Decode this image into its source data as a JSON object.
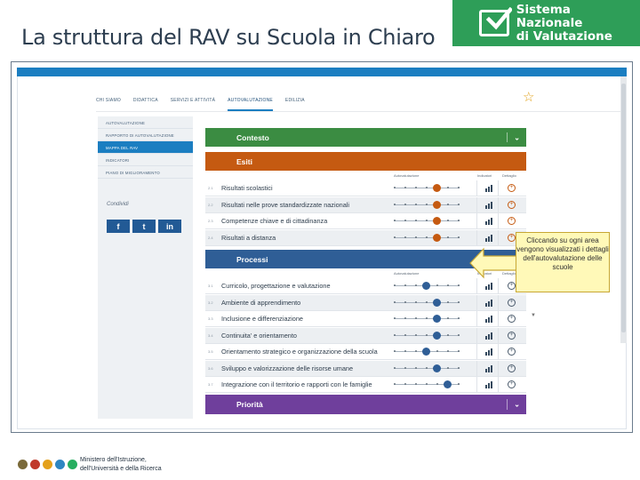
{
  "slide": {
    "title": "La struttura del RAV su Scuola in Chiaro"
  },
  "brand": {
    "line1": "Sistema Nazionale",
    "line2": "di Valutazione",
    "color": "#2e9e58"
  },
  "nav": {
    "items": [
      "CHI SIAMO",
      "DIDATTICA",
      "SERVIZI E ATTIVITÀ",
      "AUTOVALUTAZIONE",
      "EDILIZIA"
    ],
    "active": "AUTOVALUTAZIONE",
    "star": "☆"
  },
  "sidebar": {
    "items": [
      "AUTOVALUTAZIONE",
      "RAPPORTO DI AUTOVALUTAZIONE",
      "MAPPA DEL RAV",
      "INDICATORI",
      "PIANO DI MIGLIORAMENTO"
    ],
    "selected_index": 2,
    "share_label": "Condividi",
    "social": [
      "f",
      "t",
      "in"
    ]
  },
  "sections": {
    "contesto": {
      "label": "Contesto",
      "color": "#3b8c42",
      "chevron": "⌄"
    },
    "esiti": {
      "label": "Esiti",
      "color": "#c55a11",
      "chevron": "⌄"
    },
    "processi": {
      "label": "Processi",
      "color": "#2f5e96",
      "chevron": "⌄"
    },
    "priorita": {
      "label": "Priorità",
      "color": "#6f3f9c",
      "chevron": "⌄"
    }
  },
  "columns": {
    "autovalutazione": "Autovalutazione",
    "indicatori": "Indicatori",
    "dettaglio": "Dettaglio"
  },
  "esiti_rows": [
    {
      "code": "2.1",
      "label": "Risultati scolastici",
      "level": 5
    },
    {
      "code": "2.2",
      "label": "Risultati nelle prove standardizzate nazionali",
      "level": 5
    },
    {
      "code": "2.3",
      "label": "Competenze chiave e di cittadinanza",
      "level": 5
    },
    {
      "code": "2.4",
      "label": "Risultati a distanza",
      "level": 5
    }
  ],
  "processi_rows": [
    {
      "code": "3.1",
      "label": "Curricolo, progettazione e valutazione",
      "level": 4
    },
    {
      "code": "3.2",
      "label": "Ambiente di apprendimento",
      "level": 5
    },
    {
      "code": "3.3",
      "label": "Inclusione e differenziazione",
      "level": 5
    },
    {
      "code": "3.4",
      "label": "Continuita' e orientamento",
      "level": 5
    },
    {
      "code": "3.5",
      "label": "Orientamento strategico e organizzazione della scuola",
      "level": 4
    },
    {
      "code": "3.6",
      "label": "Sviluppo e valorizzazione delle risorse umane",
      "level": 5
    },
    {
      "code": "3.7",
      "label": "Integrazione con il territorio e rapporti con le famiglie",
      "level": 6
    }
  ],
  "scale_max": 7,
  "callout": {
    "text": "Cliccando su ogni area vengono visualizzati i dettagli dell'autovalutazione delle scuole"
  },
  "footer": {
    "line1": "Ministero dell'Istruzione,",
    "line2": "dell'Università e della Ricerca"
  }
}
